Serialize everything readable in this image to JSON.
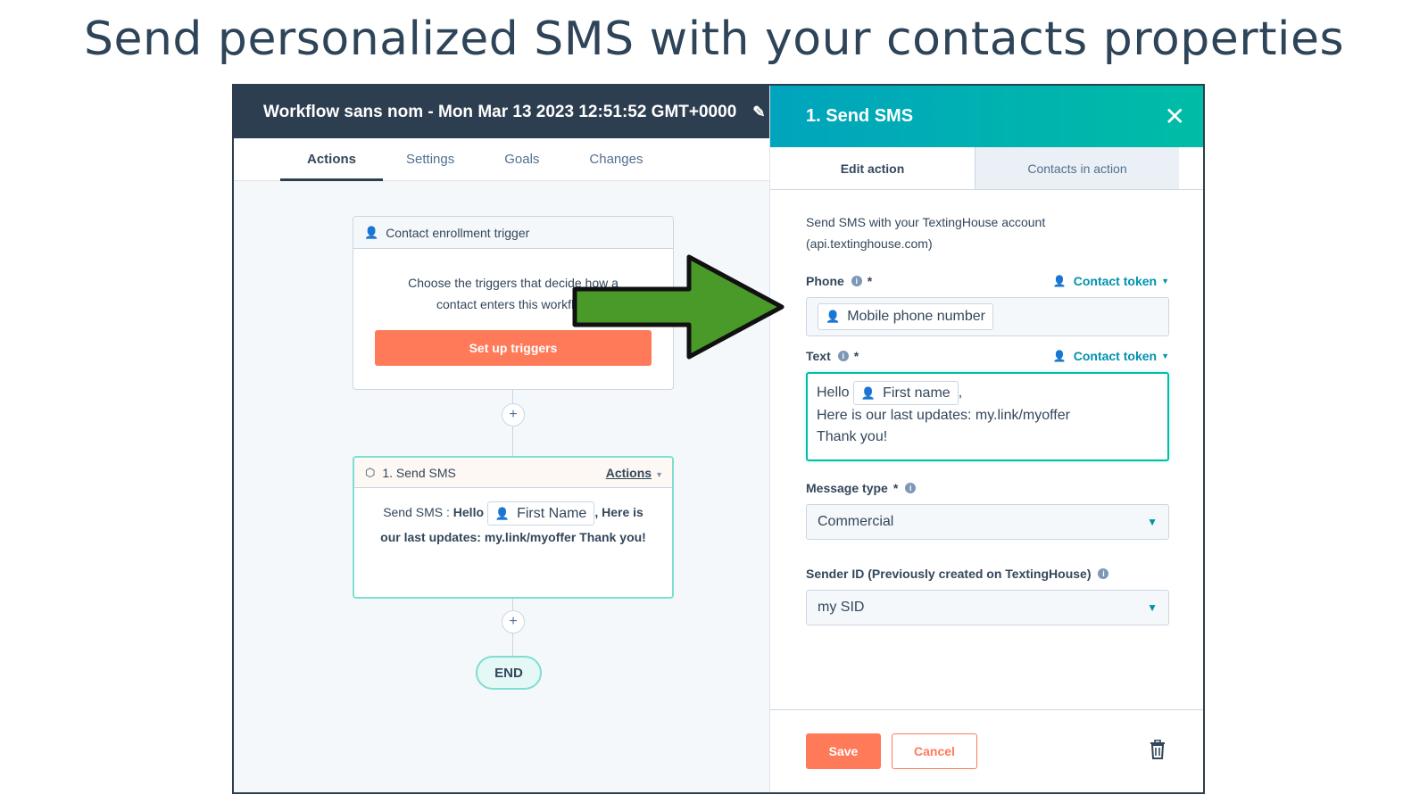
{
  "headline": "Send personalized SMS with your contacts properties",
  "workflow": {
    "title": "Workflow sans nom - Mon Mar 13 2023 12:51:52 GMT+0000",
    "tabs": [
      {
        "label": "Actions"
      },
      {
        "label": "Settings"
      },
      {
        "label": "Goals"
      },
      {
        "label": "Changes"
      }
    ],
    "trigger_card": {
      "title": "Contact enrollment trigger",
      "body": "Choose the triggers that decide how a contact enters this workflow",
      "button": "Set up triggers"
    },
    "sms_card": {
      "title": "1. Send SMS",
      "actions_link": "Actions",
      "prefix": "Send SMS : ",
      "hello": "Hello",
      "token": "First Name",
      "rest": ", Here is our last updates: my.link/myoffer Thank you!"
    },
    "end_label": "END",
    "plus": "+"
  },
  "panel": {
    "title": "1. Send SMS",
    "tabs": [
      {
        "label": "Edit action"
      },
      {
        "label": "Contacts in action"
      }
    ],
    "description": "Send SMS with your TextingHouse account (api.textinghouse.com)",
    "phone": {
      "label": "Phone",
      "token_link": "Contact token",
      "value_token": "Mobile phone number"
    },
    "text": {
      "label": "Text",
      "token_link": "Contact token",
      "hello": "Hello",
      "token": "First name",
      "comma": ",",
      "line2": "Here is our last updates: my.link/myoffer",
      "line3": "Thank you!"
    },
    "message_type": {
      "label": "Message type",
      "value": "Commercial"
    },
    "sender_id": {
      "label": "Sender ID (Previously created on TextingHouse)",
      "value": "my SID"
    },
    "save": "Save",
    "cancel": "Cancel"
  },
  "colors": {
    "accent_orange": "#ff7a59",
    "teal": "#00bda5",
    "dark_header": "#2d3e50",
    "arrow_green": "#4a9a2a"
  }
}
